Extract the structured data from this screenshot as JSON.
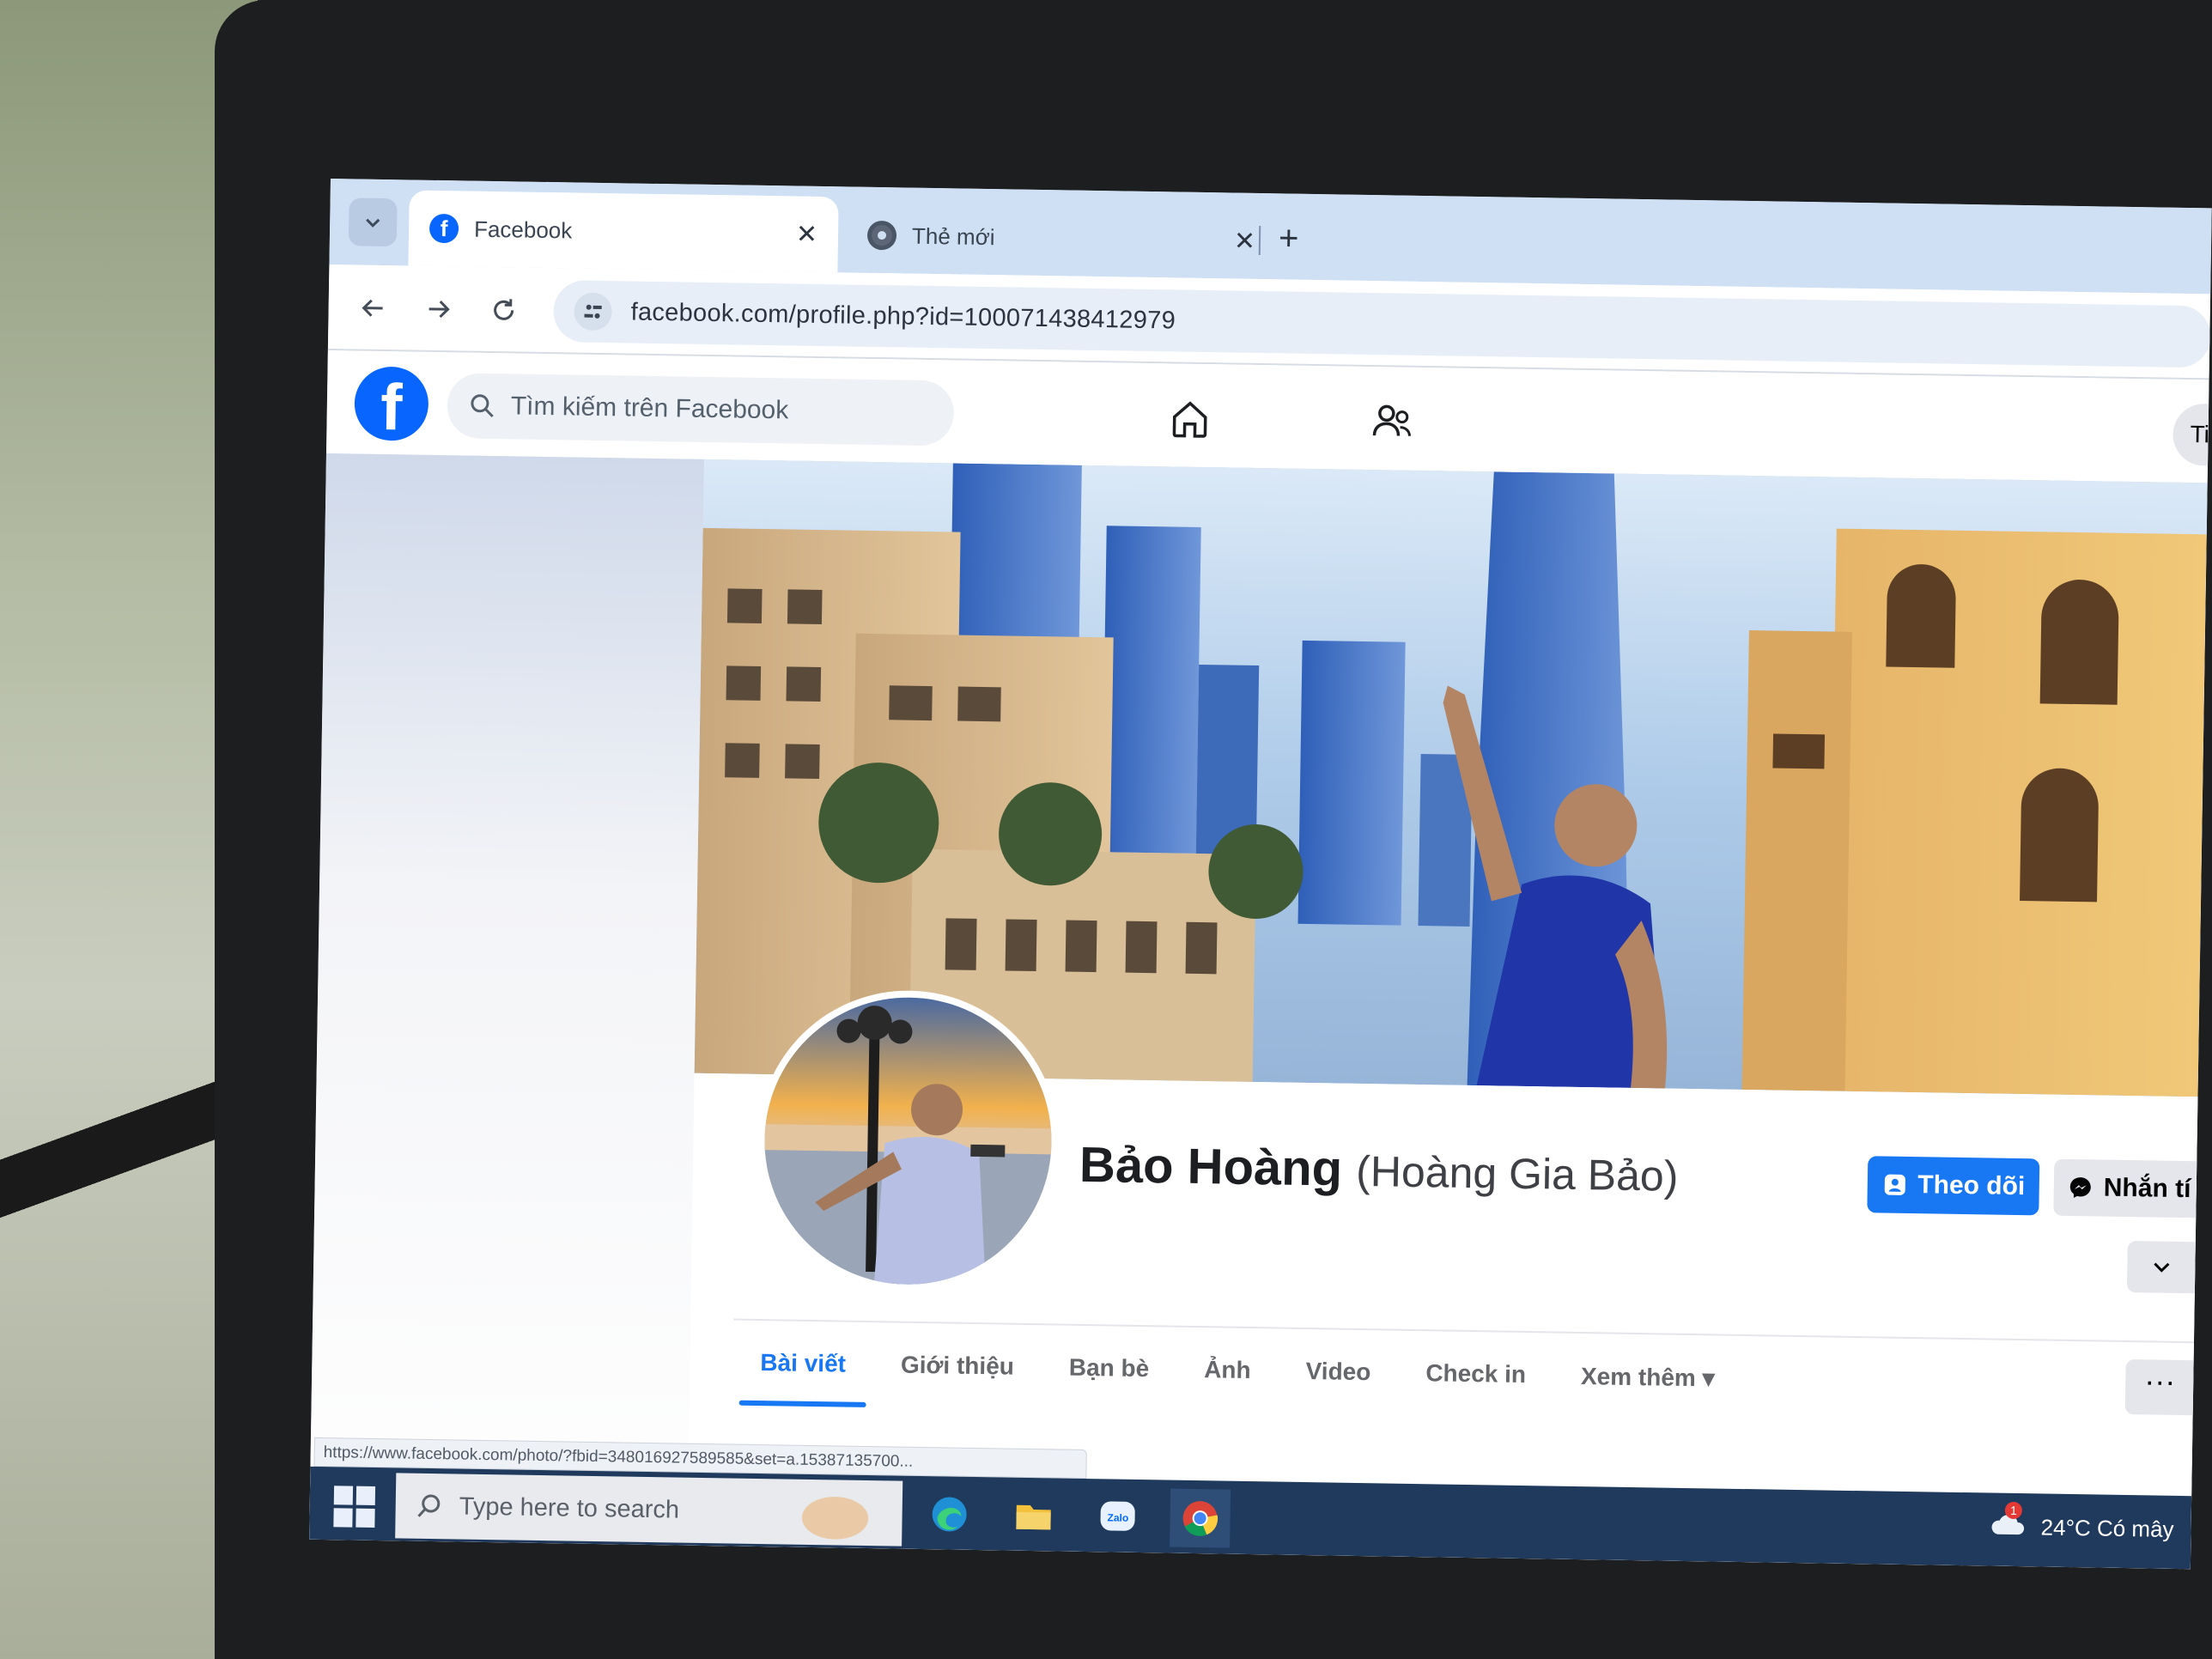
{
  "browser": {
    "tabs": [
      {
        "label": "Facebook",
        "close": "✕"
      },
      {
        "label": "Thẻ mới",
        "close": "✕"
      }
    ],
    "new_tab": "+",
    "address": "facebook.com/profile.php?id=100071438412979",
    "status_url": "https://www.facebook.com/photo/?fbid=348016927589585&set=a.15387135700..."
  },
  "fb_header": {
    "logo": "f",
    "search_placeholder": "Tìm kiếm trên Facebook",
    "right_pill_text": "Ti",
    "icons": [
      "home-icon",
      "friends-icon"
    ]
  },
  "profile": {
    "name": "Bảo Hoàng",
    "alternate_name": "(Hoàng Gia Bảo)",
    "follow_label": "Theo dõi",
    "message_label": "Nhắn tí",
    "tabs": [
      "Bài viết",
      "Giới thiệu",
      "Bạn bè",
      "Ảnh",
      "Video",
      "Check in",
      "Xem thêm"
    ],
    "active_tab": "Bài viết",
    "more_tabs_button": "···"
  },
  "taskbar": {
    "search_placeholder": "Type here to search",
    "weather": "24°C  Có mây",
    "notification_count": "1",
    "apps": [
      "edge-icon",
      "file-explorer-icon",
      "zalo-icon",
      "chrome-icon"
    ]
  },
  "colors": {
    "facebook_blue": "#1877f2",
    "logo_blue": "#0866ff",
    "taskbar": "#1f3a5c"
  }
}
